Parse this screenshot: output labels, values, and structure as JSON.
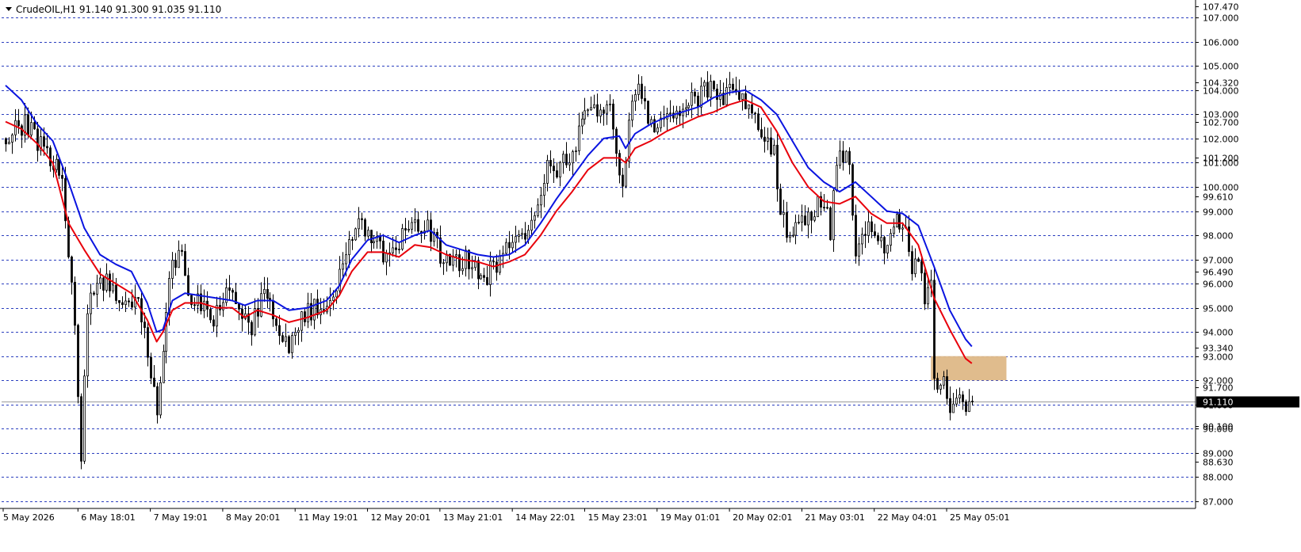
{
  "window": {
    "header_text": "CrudeOIL,H1  91.140 91.300 91.035 91.110"
  },
  "colors": {
    "background": "#ffffff",
    "grid": "#2b3fbf",
    "candles": "#000000",
    "ma_fast": "#e8000b",
    "ma_slow": "#0a14e0",
    "zone_fill": "#deb887",
    "axis": "#000000"
  },
  "chart_data": {
    "type": "candlestick",
    "symbol": "CrudeOIL",
    "timeframe": "H1",
    "ohlc_current": {
      "open": 91.14,
      "high": 91.3,
      "low": 91.035,
      "close": 91.11
    },
    "ylim": [
      86.7,
      107.6
    ],
    "grid": true,
    "y_ticks": [
      107.0,
      106.0,
      105.0,
      104.0,
      103.0,
      102.0,
      101.0,
      100.0,
      99.0,
      98.0,
      97.0,
      96.0,
      95.0,
      94.0,
      93.0,
      92.0,
      91.0,
      90.0,
      89.0,
      88.0,
      87.0
    ],
    "y_tick_labels": [
      "107.000",
      "106.000",
      "105.000",
      "104.000",
      "103.000",
      "102.000",
      "101.000",
      "100.000",
      "99.000",
      "98.000",
      "97.000",
      "96.000",
      "95.000",
      "94.000",
      "93.000",
      "92.000",
      "91.000",
      "90.000",
      "89.000",
      "88.000",
      "87.000"
    ],
    "price_marks": [
      {
        "value": 107.47,
        "label": "107.470"
      },
      {
        "value": 104.32,
        "label": "104.320"
      },
      {
        "value": 102.7,
        "label": "102.700"
      },
      {
        "value": 101.2,
        "label": "101.200"
      },
      {
        "value": 99.61,
        "label": "99.610"
      },
      {
        "value": 96.49,
        "label": "96.490"
      },
      {
        "value": 93.34,
        "label": "93.340"
      },
      {
        "value": 91.7,
        "label": "91.700"
      },
      {
        "value": 90.1,
        "label": "90.100"
      },
      {
        "value": 88.63,
        "label": "88.630"
      }
    ],
    "current_price": {
      "value": 91.11,
      "label": "91.110"
    },
    "x_tick_labels": [
      "5 May 2026",
      "6 May 18:01",
      "7 May 19:01",
      "8 May 20:01",
      "11 May 19:01",
      "12 May 20:01",
      "13 May 21:01",
      "14 May 22:01",
      "15 May 23:01",
      "19 May 01:01",
      "20 May 02:01",
      "21 May 03:01",
      "22 May 04:01",
      "25 May 05:01"
    ],
    "bars_per_label": 23,
    "price_path": [
      [
        0,
        102.0
      ],
      [
        6,
        102.6
      ],
      [
        12,
        101.6
      ],
      [
        18,
        100.5
      ],
      [
        22,
        94.0
      ],
      [
        24,
        89.0
      ],
      [
        26,
        95.0
      ],
      [
        30,
        96.3
      ],
      [
        36,
        95.3
      ],
      [
        42,
        95.0
      ],
      [
        46,
        92.5
      ],
      [
        48,
        90.5
      ],
      [
        50,
        93.0
      ],
      [
        52,
        96.0
      ],
      [
        55,
        97.6
      ],
      [
        58,
        95.6
      ],
      [
        62,
        95.0
      ],
      [
        66,
        94.6
      ],
      [
        70,
        95.6
      ],
      [
        74,
        95.0
      ],
      [
        78,
        94.2
      ],
      [
        82,
        95.6
      ],
      [
        86,
        94.5
      ],
      [
        90,
        93.2
      ],
      [
        94,
        94.6
      ],
      [
        98,
        95.0
      ],
      [
        102,
        95.3
      ],
      [
        104,
        95.5
      ],
      [
        108,
        97.4
      ],
      [
        112,
        98.5
      ],
      [
        116,
        98.1
      ],
      [
        120,
        97.2
      ],
      [
        124,
        97.5
      ],
      [
        128,
        98.2
      ],
      [
        134,
        98.5
      ],
      [
        138,
        97.1
      ],
      [
        142,
        96.8
      ],
      [
        148,
        97.0
      ],
      [
        152,
        96.2
      ],
      [
        156,
        96.8
      ],
      [
        160,
        97.5
      ],
      [
        164,
        97.9
      ],
      [
        168,
        98.8
      ],
      [
        172,
        101.0
      ],
      [
        176,
        100.8
      ],
      [
        180,
        101.5
      ],
      [
        184,
        102.8
      ],
      [
        186,
        103.5
      ],
      [
        188,
        102.8
      ],
      [
        192,
        103.2
      ],
      [
        196,
        100.0
      ],
      [
        198,
        102.8
      ],
      [
        201,
        104.4
      ],
      [
        204,
        102.6
      ],
      [
        208,
        102.5
      ],
      [
        212,
        103.0
      ],
      [
        216,
        103.5
      ],
      [
        220,
        103.6
      ],
      [
        224,
        104.3
      ],
      [
        228,
        103.7
      ],
      [
        232,
        104.1
      ],
      [
        236,
        103.2
      ],
      [
        240,
        102.4
      ],
      [
        244,
        101.3
      ],
      [
        246,
        99.0
      ],
      [
        248,
        98.0
      ],
      [
        252,
        98.7
      ],
      [
        256,
        98.8
      ],
      [
        260,
        99.6
      ],
      [
        262,
        98.0
      ],
      [
        264,
        100.9
      ],
      [
        266,
        101.4
      ],
      [
        268,
        100.7
      ],
      [
        270,
        97.4
      ],
      [
        272,
        98.4
      ],
      [
        276,
        98.0
      ],
      [
        280,
        97.4
      ],
      [
        282,
        98.3
      ],
      [
        284,
        98.6
      ],
      [
        286,
        98.0
      ],
      [
        288,
        96.5
      ],
      [
        290,
        96.8
      ],
      [
        292,
        95.3
      ],
      [
        294,
        96.5
      ],
      [
        295,
        92.5
      ],
      [
        296,
        91.3
      ],
      [
        298,
        92.1
      ],
      [
        300,
        90.6
      ],
      [
        302,
        91.6
      ],
      [
        304,
        91.0
      ],
      [
        306,
        91.2
      ],
      [
        307,
        91.11
      ]
    ],
    "series": [
      {
        "name": "",
        "color": "#e8000b",
        "points": [
          [
            0,
            102.7
          ],
          [
            5,
            102.4
          ],
          [
            10,
            101.8
          ],
          [
            15,
            101.0
          ],
          [
            20,
            98.5
          ],
          [
            25,
            97.4
          ],
          [
            30,
            96.4
          ],
          [
            35,
            96.0
          ],
          [
            40,
            95.6
          ],
          [
            45,
            94.5
          ],
          [
            48,
            93.6
          ],
          [
            50,
            94.0
          ],
          [
            53,
            94.9
          ],
          [
            57,
            95.2
          ],
          [
            62,
            95.2
          ],
          [
            67,
            95.0
          ],
          [
            72,
            95.0
          ],
          [
            76,
            94.6
          ],
          [
            80,
            94.9
          ],
          [
            85,
            94.7
          ],
          [
            90,
            94.4
          ],
          [
            96,
            94.6
          ],
          [
            102,
            94.9
          ],
          [
            106,
            95.5
          ],
          [
            110,
            96.5
          ],
          [
            115,
            97.3
          ],
          [
            120,
            97.3
          ],
          [
            125,
            97.1
          ],
          [
            130,
            97.6
          ],
          [
            135,
            97.5
          ],
          [
            140,
            97.2
          ],
          [
            145,
            97.0
          ],
          [
            150,
            96.9
          ],
          [
            155,
            96.7
          ],
          [
            160,
            96.9
          ],
          [
            165,
            97.2
          ],
          [
            170,
            98.0
          ],
          [
            175,
            99.0
          ],
          [
            180,
            99.8
          ],
          [
            185,
            100.7
          ],
          [
            190,
            101.2
          ],
          [
            195,
            101.2
          ],
          [
            197,
            101.0
          ],
          [
            200,
            101.6
          ],
          [
            205,
            101.9
          ],
          [
            210,
            102.3
          ],
          [
            215,
            102.6
          ],
          [
            220,
            102.9
          ],
          [
            225,
            103.1
          ],
          [
            230,
            103.4
          ],
          [
            235,
            103.6
          ],
          [
            240,
            103.3
          ],
          [
            245,
            102.3
          ],
          [
            250,
            101.0
          ],
          [
            255,
            100.0
          ],
          [
            260,
            99.4
          ],
          [
            265,
            99.3
          ],
          [
            270,
            99.6
          ],
          [
            275,
            98.9
          ],
          [
            280,
            98.5
          ],
          [
            285,
            98.5
          ],
          [
            290,
            97.6
          ],
          [
            295,
            95.4
          ],
          [
            300,
            94.1
          ],
          [
            305,
            92.9
          ],
          [
            307,
            92.7
          ]
        ]
      },
      {
        "name": "",
        "color": "#0a14e0",
        "points": [
          [
            0,
            104.2
          ],
          [
            5,
            103.6
          ],
          [
            10,
            102.6
          ],
          [
            15,
            101.9
          ],
          [
            20,
            100.2
          ],
          [
            25,
            98.3
          ],
          [
            30,
            97.2
          ],
          [
            35,
            96.8
          ],
          [
            40,
            96.5
          ],
          [
            45,
            95.2
          ],
          [
            48,
            94.0
          ],
          [
            50,
            94.1
          ],
          [
            53,
            95.3
          ],
          [
            57,
            95.6
          ],
          [
            62,
            95.5
          ],
          [
            67,
            95.4
          ],
          [
            72,
            95.3
          ],
          [
            76,
            95.1
          ],
          [
            80,
            95.3
          ],
          [
            85,
            95.3
          ],
          [
            90,
            94.9
          ],
          [
            96,
            95.0
          ],
          [
            102,
            95.3
          ],
          [
            106,
            95.9
          ],
          [
            110,
            97.0
          ],
          [
            115,
            97.8
          ],
          [
            120,
            98.0
          ],
          [
            125,
            97.7
          ],
          [
            130,
            98.0
          ],
          [
            135,
            98.2
          ],
          [
            140,
            97.6
          ],
          [
            145,
            97.4
          ],
          [
            150,
            97.2
          ],
          [
            155,
            97.1
          ],
          [
            160,
            97.2
          ],
          [
            165,
            97.6
          ],
          [
            170,
            98.5
          ],
          [
            175,
            99.5
          ],
          [
            180,
            100.4
          ],
          [
            185,
            101.3
          ],
          [
            190,
            102.0
          ],
          [
            195,
            102.1
          ],
          [
            197,
            101.6
          ],
          [
            200,
            102.2
          ],
          [
            205,
            102.6
          ],
          [
            210,
            102.9
          ],
          [
            215,
            103.1
          ],
          [
            220,
            103.3
          ],
          [
            225,
            103.7
          ],
          [
            230,
            103.9
          ],
          [
            235,
            104.0
          ],
          [
            240,
            103.6
          ],
          [
            245,
            103.0
          ],
          [
            250,
            101.9
          ],
          [
            255,
            100.8
          ],
          [
            260,
            100.2
          ],
          [
            265,
            99.8
          ],
          [
            270,
            100.2
          ],
          [
            275,
            99.6
          ],
          [
            280,
            99.0
          ],
          [
            285,
            98.9
          ],
          [
            290,
            98.4
          ],
          [
            295,
            96.7
          ],
          [
            300,
            94.9
          ],
          [
            305,
            93.7
          ],
          [
            307,
            93.4
          ]
        ]
      }
    ],
    "zones": [
      {
        "x_start": 294,
        "x_end": 318,
        "y_low": 92.0,
        "y_high": 93.0,
        "color": "#deb887"
      }
    ]
  }
}
